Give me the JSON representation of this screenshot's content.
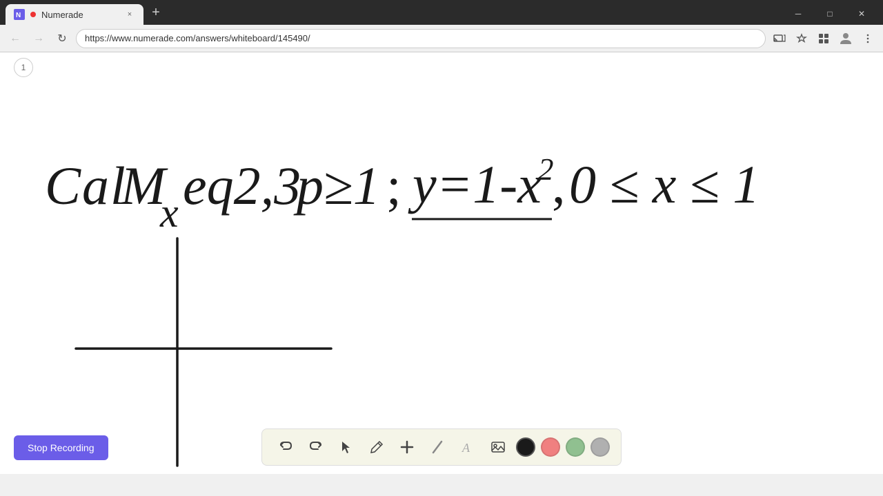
{
  "browser": {
    "tab": {
      "favicon": "N",
      "title": "Numerade",
      "close_label": "×",
      "new_tab_label": "+"
    },
    "nav": {
      "back_label": "←",
      "forward_label": "→",
      "refresh_label": "↻",
      "url": "https://www.numerade.com/answers/whiteboard/145490/",
      "menu_label": "⋮"
    },
    "win_controls": {
      "minimize": "─",
      "maximize": "□",
      "close": "✕"
    }
  },
  "whiteboard": {
    "page_number": "1",
    "math_text": "Cal Mx eq2,3  p≥1 ; y=1-x², 0 ≤ x ≤ 1"
  },
  "toolbar": {
    "undo_label": "↺",
    "redo_label": "↻",
    "select_label": "▲",
    "pen_label": "✏",
    "plus_label": "+",
    "eraser_label": "/",
    "text_label": "A",
    "image_label": "🖼",
    "colors": {
      "black": "#1a1a1a",
      "pink": "#f08080",
      "green": "#90c090",
      "gray": "#b0b0b0"
    }
  },
  "stop_recording": {
    "label": "Stop Recording"
  }
}
